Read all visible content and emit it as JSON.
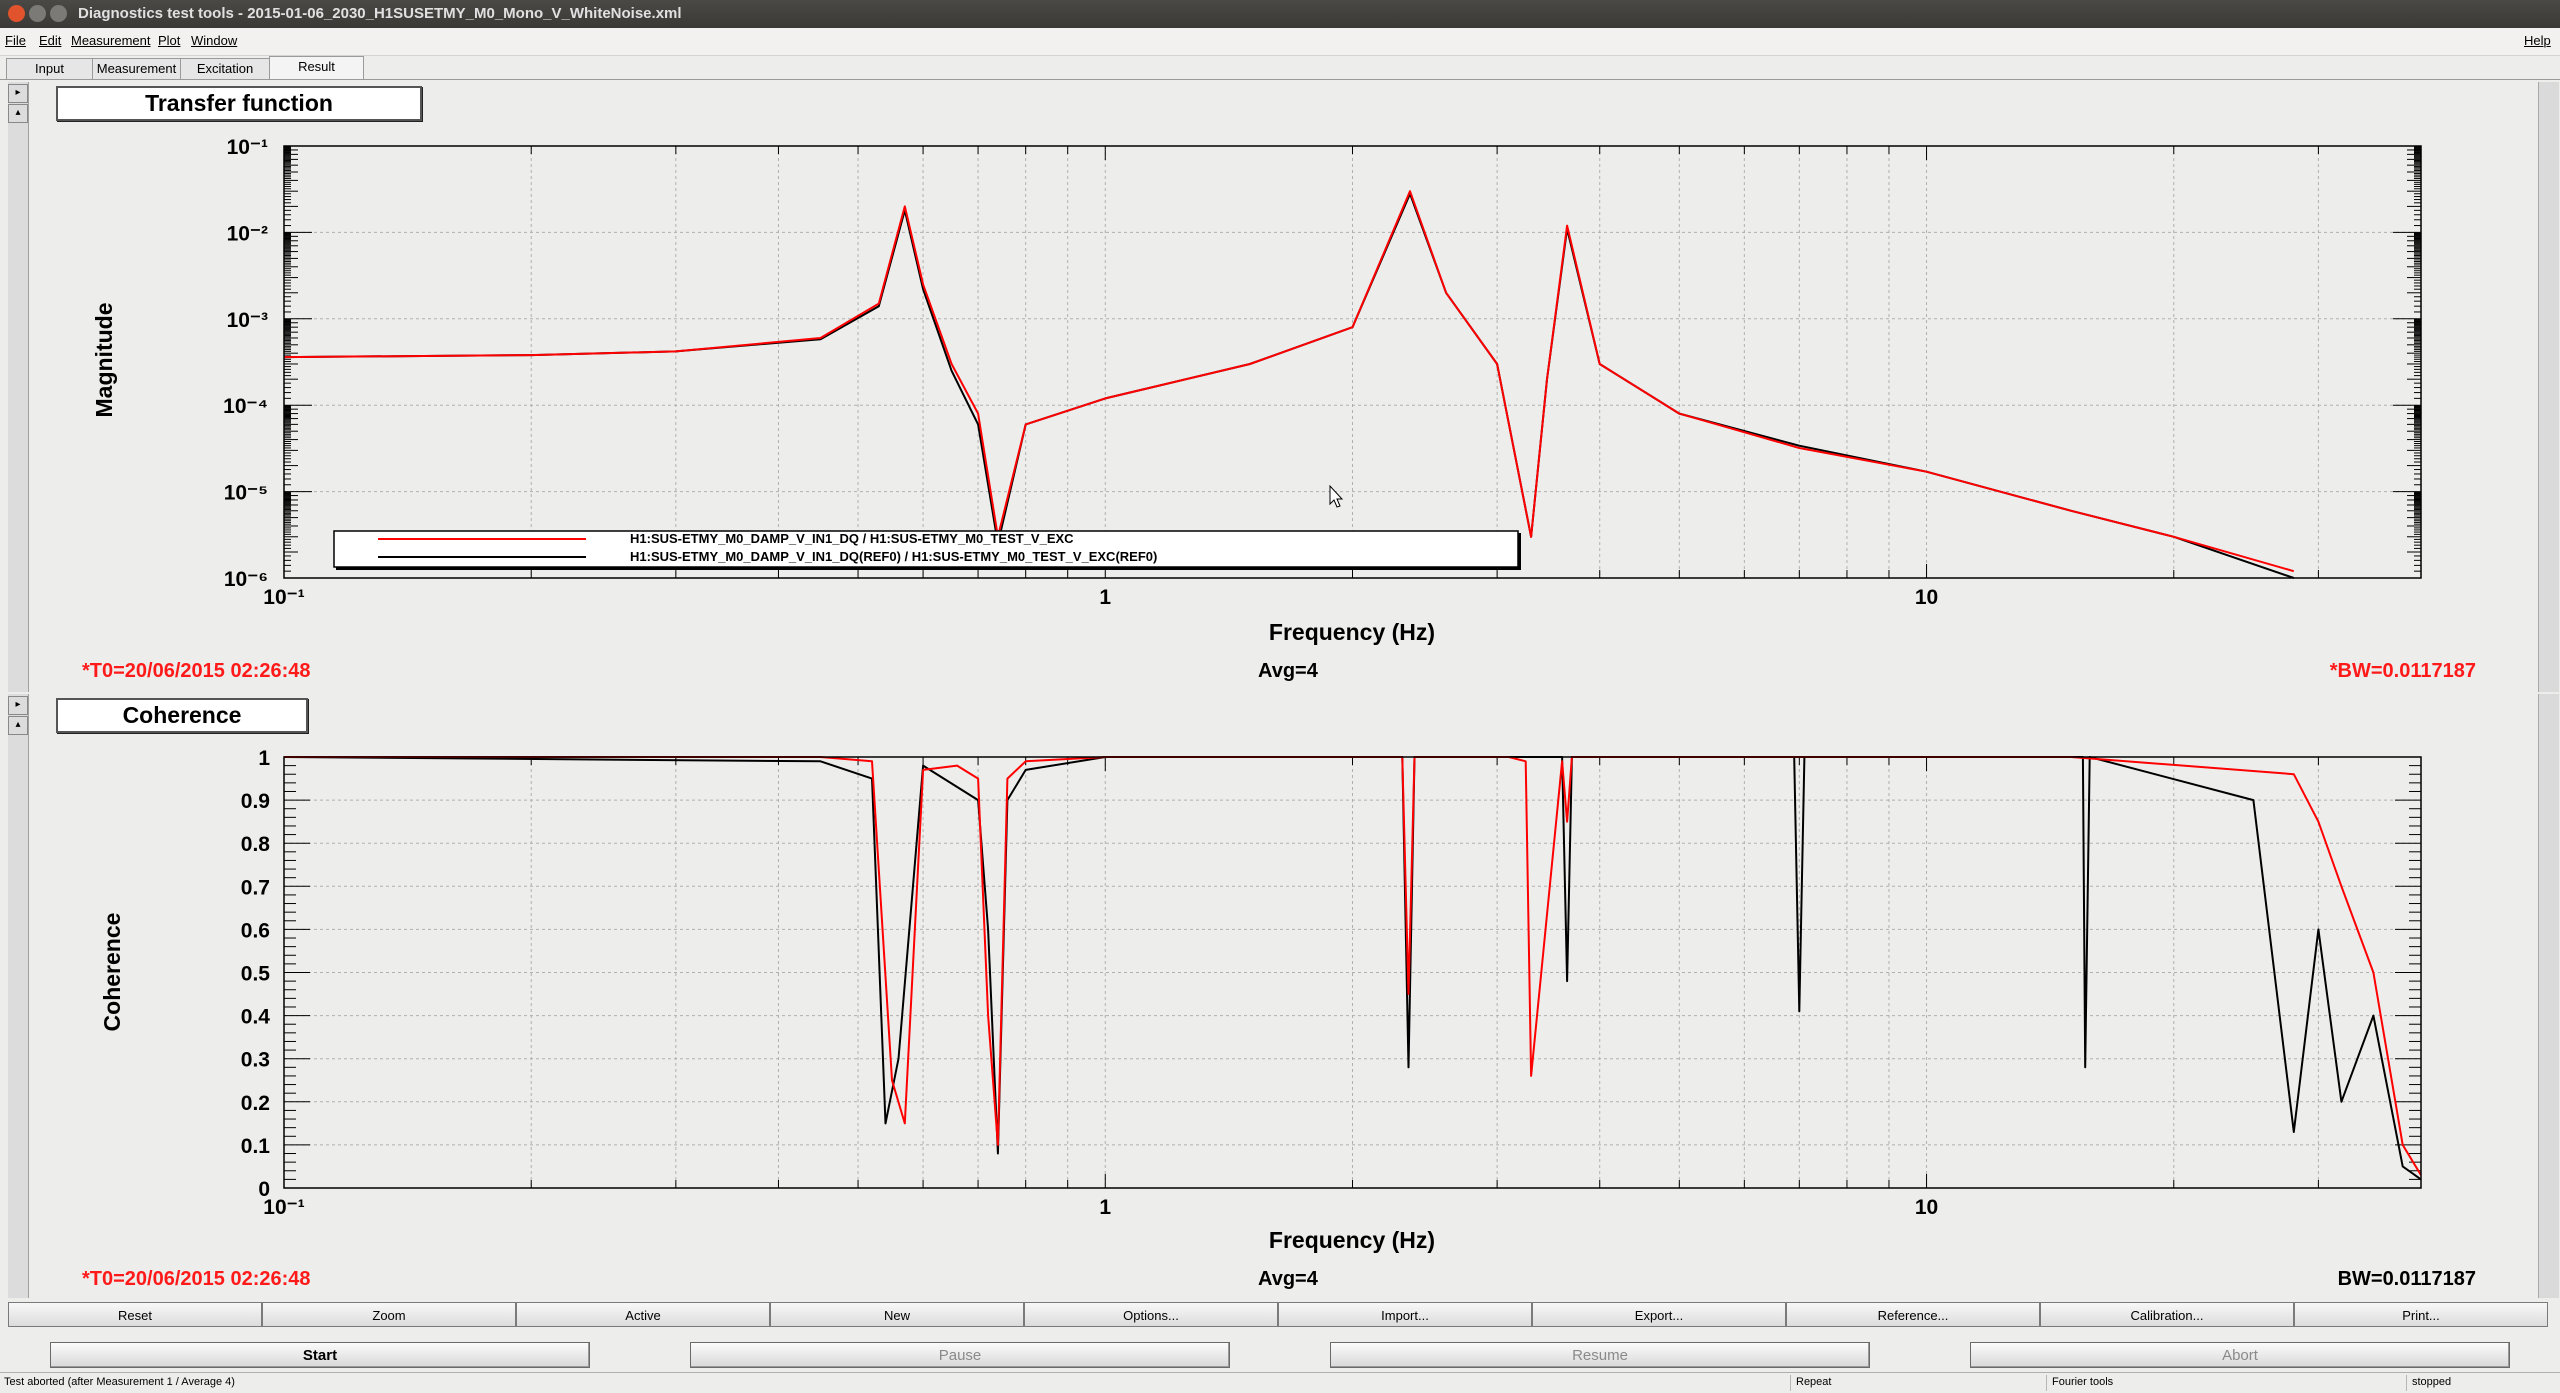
{
  "window": {
    "title": "Diagnostics test tools - 2015-01-06_2030_H1SUSETMY_M0_Mono_V_WhiteNoise.xml",
    "buttons": [
      "close",
      "minimize",
      "maximize"
    ]
  },
  "menubar": {
    "items": [
      "File",
      "Edit",
      "Measurement",
      "Plot",
      "Window"
    ],
    "help": "Help"
  },
  "tabs": [
    {
      "label": "Input"
    },
    {
      "label": "Measurement"
    },
    {
      "label": "Excitation"
    },
    {
      "label": "Result",
      "active": true
    }
  ],
  "graph1": {
    "title": "Transfer function",
    "info_left": "*T0=20/06/2015 02:26:48",
    "info_mid": "Avg=4",
    "info_right": "*BW=0.0117187",
    "info_right_color": "#ff1a1a"
  },
  "graph2": {
    "title": "Coherence",
    "info_left": "*T0=20/06/2015 02:26:48",
    "info_mid": "Avg=4",
    "info_right": "BW=0.0117187",
    "info_right_color": "#000000"
  },
  "chart_data": [
    {
      "type": "line",
      "title": "Transfer function",
      "xlabel": "Frequency (Hz)",
      "ylabel": "Magnitude",
      "xscale": "log",
      "yscale": "log",
      "xlim": [
        0.1,
        40
      ],
      "ylim": [
        1e-06,
        0.1
      ],
      "x_ticks": [
        "10⁻¹",
        "1",
        "10"
      ],
      "y_ticks": [
        "10⁻⁶",
        "10⁻⁵",
        "10⁻⁴",
        "10⁻³",
        "10⁻²",
        "10⁻¹"
      ],
      "grid": true,
      "legend": "bottom-left",
      "series": [
        {
          "name": "H1:SUS-ETMY_M0_DAMP_V_IN1_DQ / H1:SUS-ETMY_M0_TEST_V_EXC",
          "color": "#ff0000",
          "x": [
            0.1,
            0.2,
            0.3,
            0.45,
            0.53,
            0.57,
            0.6,
            0.65,
            0.7,
            0.74,
            0.8,
            1.0,
            1.5,
            2.0,
            2.35,
            2.6,
            3.0,
            3.3,
            3.45,
            3.65,
            4.0,
            5.0,
            7.0,
            10.0,
            15.0,
            20.0,
            28.0
          ],
          "y": [
            0.00036,
            0.00038,
            0.00042,
            0.0006,
            0.0015,
            0.02,
            0.0025,
            0.0003,
            8e-05,
            3e-06,
            6e-05,
            0.00012,
            0.0003,
            0.0008,
            0.03,
            0.002,
            0.0003,
            3e-06,
            0.0002,
            0.012,
            0.0003,
            8e-05,
            3.2e-05,
            1.7e-05,
            6e-06,
            3e-06,
            1.2e-06
          ]
        },
        {
          "name": "H1:SUS-ETMY_M0_DAMP_V_IN1_DQ(REF0) / H1:SUS-ETMY_M0_TEST_V_EXC(REF0)",
          "color": "#000000",
          "x": [
            0.1,
            0.2,
            0.3,
            0.45,
            0.53,
            0.57,
            0.6,
            0.65,
            0.7,
            0.74,
            0.8,
            1.0,
            1.5,
            2.0,
            2.35,
            2.6,
            3.0,
            3.3,
            3.45,
            3.65,
            4.0,
            5.0,
            7.0,
            10.0,
            15.0,
            20.0,
            28.0
          ],
          "y": [
            0.00036,
            0.00038,
            0.00042,
            0.00058,
            0.0014,
            0.018,
            0.0022,
            0.00025,
            6e-05,
            2.5e-06,
            6e-05,
            0.00012,
            0.0003,
            0.0008,
            0.028,
            0.002,
            0.0003,
            3e-06,
            0.0002,
            0.011,
            0.0003,
            8e-05,
            3.4e-05,
            1.7e-05,
            6e-06,
            3e-06,
            1e-06
          ]
        }
      ]
    },
    {
      "type": "line",
      "title": "Coherence",
      "xlabel": "Frequency (Hz)",
      "ylabel": "Coherence",
      "xscale": "log",
      "yscale": "linear",
      "xlim": [
        0.1,
        40
      ],
      "ylim": [
        0,
        1
      ],
      "x_ticks": [
        "10⁻¹",
        "1",
        "10"
      ],
      "y_ticks": [
        "0",
        "0.1",
        "0.2",
        "0.3",
        "0.4",
        "0.5",
        "0.6",
        "0.7",
        "0.8",
        "0.9",
        "1"
      ],
      "grid": true,
      "series": [
        {
          "color": "#ff0000",
          "x": [
            0.1,
            0.45,
            0.52,
            0.55,
            0.57,
            0.6,
            0.66,
            0.7,
            0.72,
            0.74,
            0.76,
            0.8,
            1.0,
            2.3,
            2.34,
            2.38,
            3.1,
            3.25,
            3.3,
            3.6,
            3.65,
            3.7,
            7.0,
            15.0,
            28.0,
            30.0,
            32.0,
            35.0,
            38.0,
            40.0
          ],
          "y": [
            1.0,
            1.0,
            0.99,
            0.25,
            0.15,
            0.97,
            0.98,
            0.95,
            0.4,
            0.1,
            0.95,
            0.99,
            1.0,
            1.0,
            0.45,
            1.0,
            1.0,
            0.99,
            0.26,
            0.99,
            0.85,
            1.0,
            1.0,
            1.0,
            0.96,
            0.85,
            0.7,
            0.5,
            0.1,
            0.03
          ]
        },
        {
          "color": "#000000",
          "x": [
            0.1,
            0.45,
            0.52,
            0.54,
            0.56,
            0.6,
            0.7,
            0.72,
            0.74,
            0.76,
            0.8,
            1.0,
            2.3,
            2.34,
            2.38,
            3.6,
            3.65,
            3.7,
            6.9,
            7.0,
            7.1,
            15.5,
            15.6,
            15.8,
            25.0,
            28.0,
            30.0,
            32.0,
            35.0,
            38.0,
            40.0
          ],
          "y": [
            1.0,
            0.99,
            0.95,
            0.15,
            0.3,
            0.98,
            0.9,
            0.6,
            0.08,
            0.9,
            0.97,
            1.0,
            1.0,
            0.28,
            1.0,
            1.0,
            0.48,
            1.0,
            1.0,
            0.41,
            1.0,
            1.0,
            0.28,
            1.0,
            0.9,
            0.13,
            0.6,
            0.2,
            0.4,
            0.05,
            0.02
          ]
        }
      ]
    }
  ],
  "toolbar": [
    "Reset",
    "Zoom",
    "Active",
    "New",
    "Options...",
    "Import...",
    "Export...",
    "Reference...",
    "Calibration...",
    "Print..."
  ],
  "controls": [
    {
      "label": "Start",
      "enabled": true
    },
    {
      "label": "Pause",
      "enabled": false
    },
    {
      "label": "Resume",
      "enabled": false
    },
    {
      "label": "Abort",
      "enabled": false
    }
  ],
  "status": {
    "message": "Test aborted (after Measurement 1 / Average 4)",
    "mode": "Repeat",
    "tool": "Fourier tools",
    "state": "stopped"
  }
}
